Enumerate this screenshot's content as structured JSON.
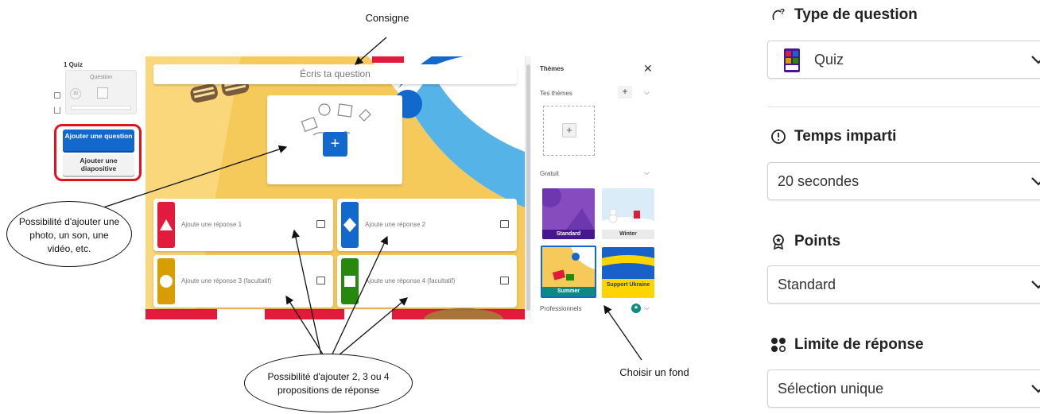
{
  "editor": {
    "slide_number_label": "1  Quiz",
    "thumbnail_title": "Question",
    "thumbnail_timer": "20",
    "add_question_button": "Ajouter une question",
    "add_slide_button": "Ajouter une diapositive",
    "question_placeholder": "Écris ta question",
    "answers": [
      {
        "placeholder": "Ajoute une réponse 1",
        "color": "#e21b3c",
        "shape": "triangle"
      },
      {
        "placeholder": "Ajoute une réponse 2",
        "color": "#1368ce",
        "shape": "diamond"
      },
      {
        "placeholder": "Ajoute une réponse 3 (facultatif)",
        "color": "#d89e00",
        "shape": "circle"
      },
      {
        "placeholder": "Ajoute une réponse 4 (facultatif)",
        "color": "#26890c",
        "shape": "square"
      }
    ]
  },
  "themes_panel": {
    "title": "Thèmes",
    "your_themes_label": "Tes thèmes",
    "free_label": "Gratuit",
    "themes": [
      {
        "name": "Standard"
      },
      {
        "name": "Winter"
      },
      {
        "name": "Summer",
        "selected": true
      },
      {
        "name": "Support Ukraine"
      }
    ],
    "professional_label": "Professionnels"
  },
  "annotations": {
    "consigne": "Consigne",
    "media_note": "Possibilité d'ajouter une photo, un son, une vidéo, etc.",
    "answers_note": "Possibilité d'ajouter 2, 3 ou 4 propositions de réponse",
    "background_note": "Choisir un fond"
  },
  "settings": {
    "question_type": {
      "label": "Type de question",
      "value": "Quiz"
    },
    "time_limit": {
      "label": "Temps imparti",
      "value": "20 secondes"
    },
    "points": {
      "label": "Points",
      "value": "Standard"
    },
    "answer_limit": {
      "label": "Limite de réponse",
      "value": "Sélection unique"
    }
  },
  "colors": {
    "kahoot_blue": "#1368ce",
    "highlight_red": "#e0141e",
    "summer_yellow": "#f6c95b"
  }
}
